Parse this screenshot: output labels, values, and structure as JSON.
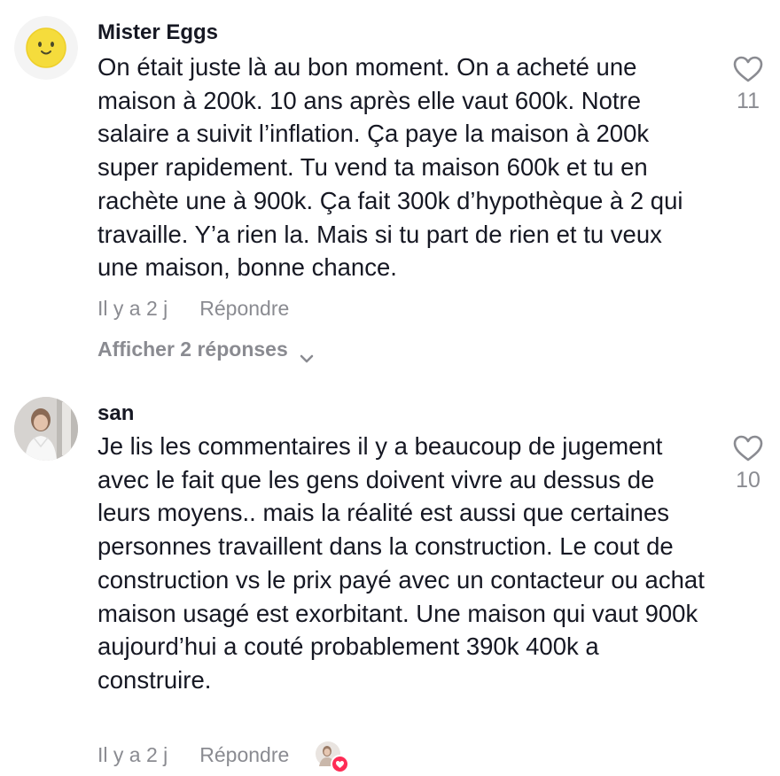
{
  "comments": [
    {
      "username": "Mister Eggs",
      "avatar_icon": "egg-face-icon",
      "text": "On était juste là au bon moment. On a acheté une maison à 200k. 10 ans après elle vaut 600k. Notre salaire a suivit l’inflation. Ça paye la maison à 200k super rapidement. Tu vend ta maison 600k et tu en rachète une à 900k. Ça fait 300k d’hypothèque à 2 qui travaille. Y’a rien la. Mais si tu part de rien et tu veux une maison, bonne chance.",
      "time": "Il y a 2 j",
      "reply_label": "Répondre",
      "like_count": "11",
      "show_replies_label": "Afficher 2 réponses"
    },
    {
      "username": "san",
      "avatar_icon": "user-photo",
      "text": "Je lis les commentaires il y a beaucoup de jugement avec le fait que les gens doivent vivre au dessus de leurs moyens.. mais la réalité est aussi que certaines personnes travaillent dans la construction. Le cout de construction vs le prix payé avec un contacteur ou achat maison usagé est exorbitant. Une maison qui vaut 900k aujourd’hui a couté probablement 390k 400k a construire.",
      "time": "Il y a 2 j",
      "reply_label": "Répondre",
      "like_count": "10",
      "creator_liked": true
    }
  ],
  "colors": {
    "text_primary": "#161823",
    "text_secondary": "#8a8b91",
    "accent_like": "#fe2c55"
  },
  "icons": {
    "like": "heart-outline-icon",
    "expand": "chevron-down-icon",
    "creator_like_badge": "heart-badge-icon"
  }
}
